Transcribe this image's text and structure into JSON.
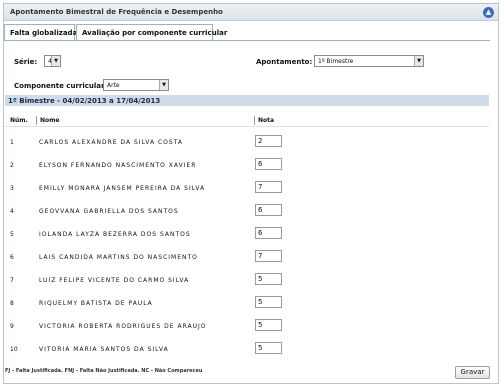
{
  "panel": {
    "title": "Apontamento Bimestral de Frequência e Desempenho",
    "collapse_icon": "▲"
  },
  "tabs": [
    "Falta globalizada",
    "Avaliação por componente curricular"
  ],
  "filters": {
    "serie_label": "Série:",
    "serie_value": "4",
    "apontamento_label": "Apontamento:",
    "apontamento_value": "1º Bimestre",
    "componente_label": "Componente curricular:",
    "componente_value": "Arte"
  },
  "period": "1º Bimestre - 04/02/2013 a 17/04/2013",
  "table": {
    "headers": [
      "Núm.",
      "Nome",
      "Nota"
    ],
    "rows": [
      {
        "num": "1",
        "name": "CARLOS ALEXANDRE DA SILVA COSTA",
        "grade": "2"
      },
      {
        "num": "2",
        "name": "ELYSON FERNANDO NASCIMENTO XAVIER",
        "grade": "6"
      },
      {
        "num": "3",
        "name": "EMILLY MONARA JANSEM PEREIRA DA SILVA",
        "grade": "7"
      },
      {
        "num": "4",
        "name": "GEOVVANA GABRIELLA DOS SANTOS",
        "grade": "6"
      },
      {
        "num": "5",
        "name": "IOLANDA LAYZA BEZERRA DOS SANTOS",
        "grade": "6"
      },
      {
        "num": "6",
        "name": "LAIS CANDIDA MARTINS DO NASCIMENTO",
        "grade": "7"
      },
      {
        "num": "7",
        "name": "LUIZ FELIPE VICENTE DO CARMO SILVA",
        "grade": "5"
      },
      {
        "num": "8",
        "name": "RIQUELMY BATISTA DE PAULA",
        "grade": "5"
      },
      {
        "num": "9",
        "name": "VICTORIA ROBERTA RODRIGUES DE ARAUJO",
        "grade": "5"
      },
      {
        "num": "10",
        "name": "VITORIA MARIA SANTOS DA SILVA",
        "grade": "5"
      }
    ]
  },
  "footer_note": "FJ - Falta Justificada. FNJ - Falta Não Justificada. NC - Não Compareceu",
  "save_button": "Gravar"
}
